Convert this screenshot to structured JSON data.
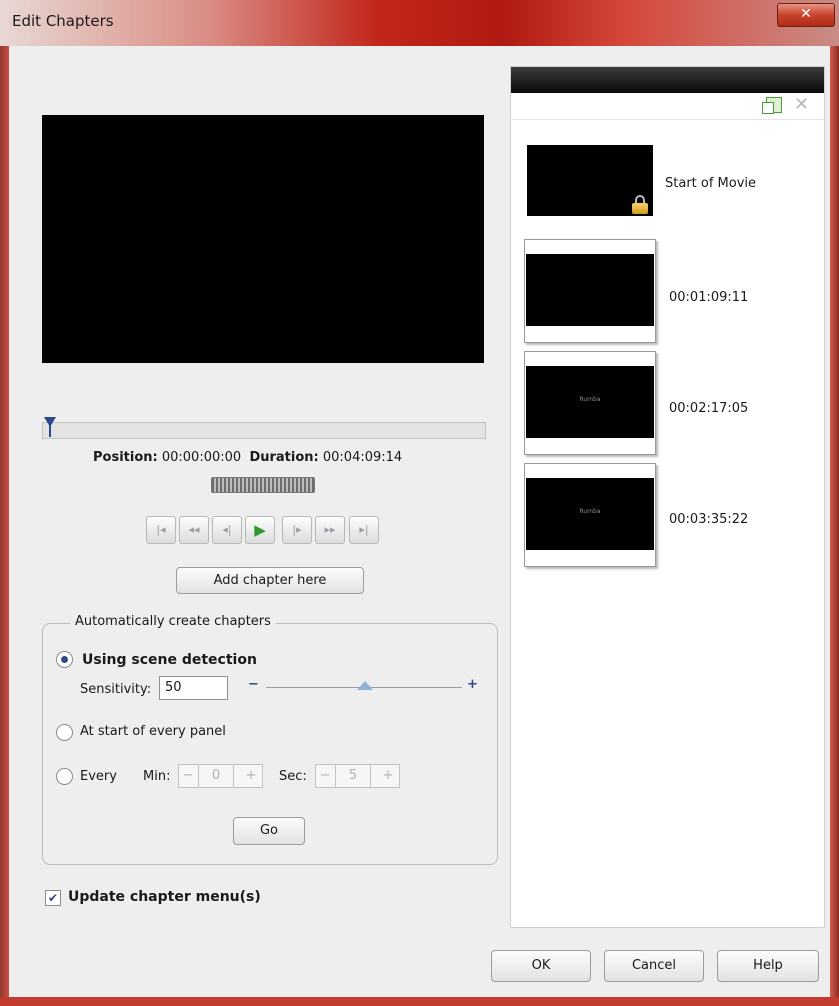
{
  "window": {
    "title": "Edit Chapters",
    "close_glyph": "✕"
  },
  "player": {
    "position_label": "Position:",
    "position_value": "00:00:00:00",
    "duration_label": "Duration:",
    "duration_value": "00:04:09:14",
    "timeline_position": 0.0
  },
  "transport": [
    {
      "name": "go-to-start",
      "glyph": "|◂"
    },
    {
      "name": "rewind",
      "glyph": "◂◂"
    },
    {
      "name": "step-back",
      "glyph": "◂|"
    },
    {
      "name": "play",
      "glyph": "▶"
    },
    {
      "name": "step-forward",
      "glyph": "|▸"
    },
    {
      "name": "fast-forward",
      "glyph": "▸▸"
    },
    {
      "name": "go-to-end",
      "glyph": "▸|"
    }
  ],
  "add_chapter_label": "Add chapter here",
  "auto": {
    "group_title": "Automatically create chapters",
    "scene_detection_label": "Using scene detection",
    "sensitivity_label": "Sensitivity:",
    "sensitivity_value": "50",
    "slider_minus": "−",
    "slider_plus": "+",
    "every_panel_label": "At start of every panel",
    "every_label": "Every",
    "min_label": "Min:",
    "min_value": "0",
    "sec_label": "Sec:",
    "sec_value": "5",
    "stepper_minus": "−",
    "stepper_plus": "+",
    "go_label": "Go"
  },
  "update_menu_label": "Update chapter menu(s)",
  "update_menu_checked": true,
  "chapters": [
    {
      "label": "Start of Movie",
      "locked": true
    },
    {
      "label": "00:01:09:11",
      "caption": ""
    },
    {
      "label": "00:02:17:05",
      "caption": "Rumba"
    },
    {
      "label": "00:03:35:22",
      "caption": "Rumba"
    }
  ],
  "footer": {
    "ok_label": "OK",
    "cancel_label": "Cancel",
    "help_label": "Help"
  },
  "colors": {
    "accent": "#2c4a8a",
    "play": "#2e9a2e",
    "title_bar": "#c2261b"
  }
}
